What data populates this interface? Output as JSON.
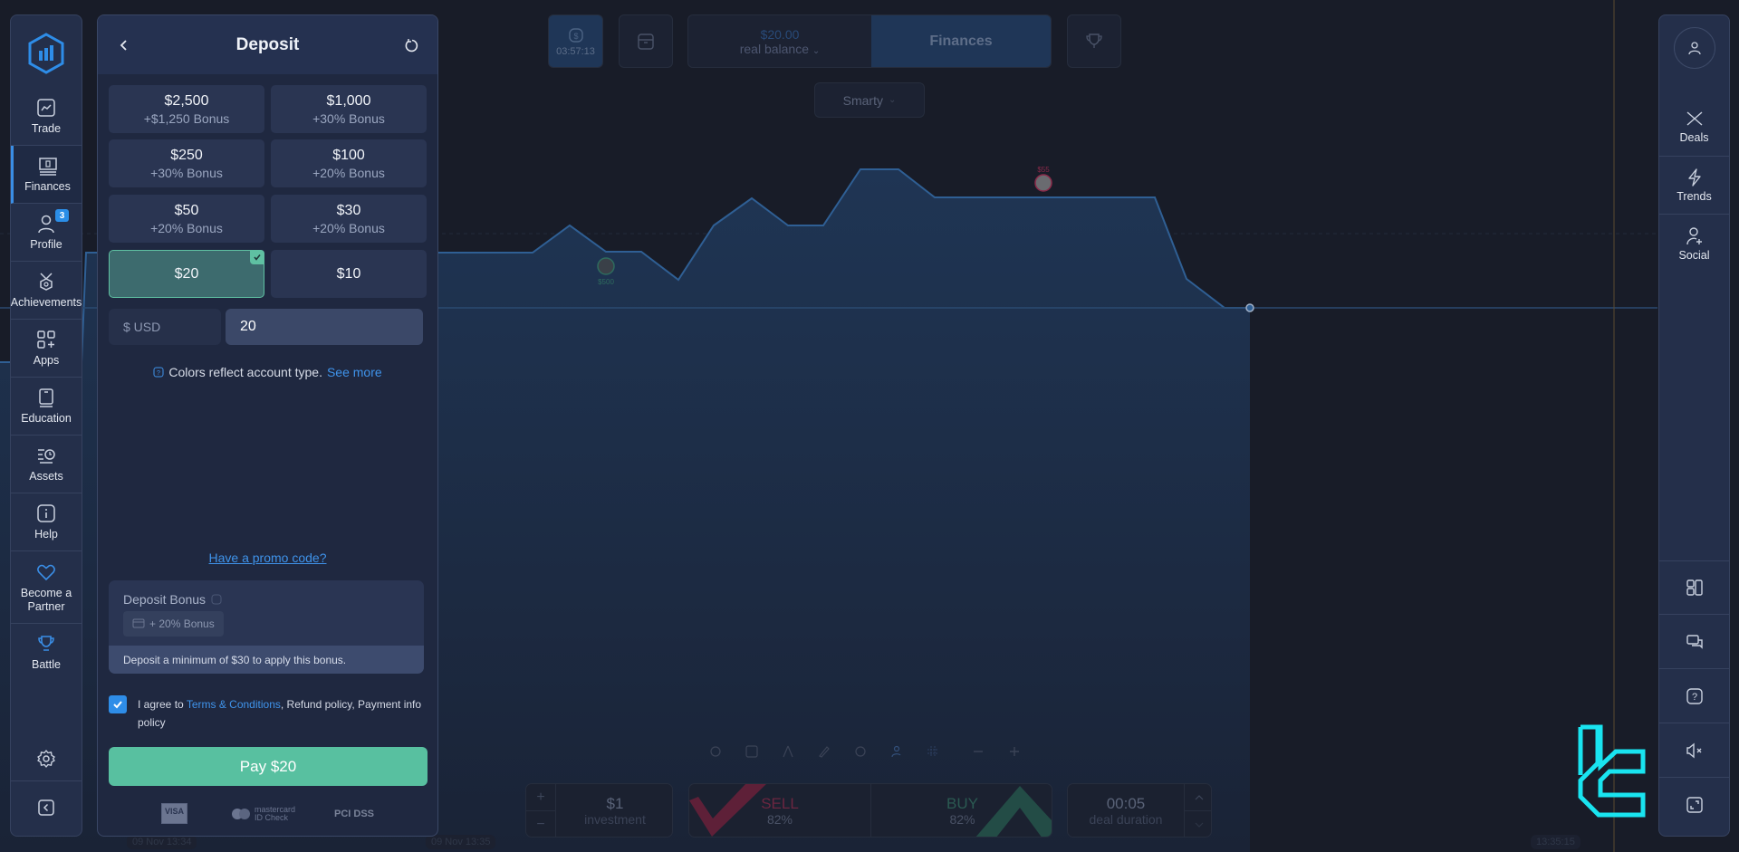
{
  "left_sidebar": {
    "logo": "app-logo",
    "items": [
      {
        "label": "Trade",
        "icon": "chart-line-icon"
      },
      {
        "label": "Finances",
        "icon": "finances-icon",
        "active": true
      },
      {
        "label": "Profile",
        "icon": "user-icon",
        "badge": "3"
      },
      {
        "label": "Achievements",
        "icon": "medal-icon"
      },
      {
        "label": "Apps",
        "icon": "apps-icon"
      },
      {
        "label": "Education",
        "icon": "book-icon"
      },
      {
        "label": "Assets",
        "icon": "assets-icon"
      },
      {
        "label": "Help",
        "icon": "info-icon"
      },
      {
        "label": "Become a Partner",
        "icon": "heart-icon"
      },
      {
        "label": "Battle",
        "icon": "trophy-icon"
      }
    ],
    "settings_icon": "gear-icon",
    "collapse_icon": "collapse-left-icon"
  },
  "deposit": {
    "title": "Deposit",
    "amounts": [
      {
        "value": "$2,500",
        "bonus": "+$1,250 Bonus"
      },
      {
        "value": "$1,000",
        "bonus": "+30% Bonus"
      },
      {
        "value": "$250",
        "bonus": "+30% Bonus"
      },
      {
        "value": "$100",
        "bonus": "+20% Bonus"
      },
      {
        "value": "$50",
        "bonus": "+20% Bonus"
      },
      {
        "value": "$30",
        "bonus": "+20% Bonus"
      },
      {
        "value": "$20",
        "bonus": "",
        "selected": true
      },
      {
        "value": "$10",
        "bonus": ""
      }
    ],
    "currency": "$ USD",
    "amount_value": "20",
    "info_text": "Colors reflect account type.",
    "info_link": "See more",
    "promo_link": "Have a promo code?",
    "bonus": {
      "title": "Deposit Bonus",
      "chip": "+ 20% Bonus",
      "note": "Deposit a minimum of $30 to apply this bonus."
    },
    "agree": {
      "checked": true,
      "prefix": "I agree to ",
      "terms_link": "Terms & Conditions",
      "suffix": ", Refund policy, Payment info policy"
    },
    "pay_button": "Pay $20",
    "payment_logos": [
      "VISA",
      "mastercard ID Check",
      "PCI DSS"
    ]
  },
  "topbar": {
    "timer": "03:57:13",
    "balance_amount": "$20.00",
    "balance_label": "real balance",
    "finances_button": "Finances",
    "strategy": "Smarty"
  },
  "right_sidebar": {
    "items": [
      {
        "label": "Deals",
        "icon": "deals-icon"
      },
      {
        "label": "Trends",
        "icon": "lightning-icon"
      },
      {
        "label": "Social",
        "icon": "add-user-icon"
      }
    ],
    "bottom_icons": [
      "layout-icon",
      "chat-icon",
      "help-icon",
      "sound-mute-icon",
      "fullscreen-icon"
    ]
  },
  "chart": {
    "marker_low_label": "$500",
    "marker_high_label": "$55",
    "dates": [
      "09 Nov 13:34",
      "09 Nov 13:35"
    ],
    "time_label": "13:35:15",
    "series_color": "#2f5f94",
    "fill_color": "#1e3150"
  },
  "trade_panel": {
    "investment_value": "$1",
    "investment_label": "investment",
    "sell_label": "SELL",
    "sell_percent": "82%",
    "buy_label": "BUY",
    "buy_percent": "82%",
    "duration_value": "00:05",
    "duration_label": "deal duration"
  },
  "colors": {
    "accent": "#3a8ee6",
    "pay": "#58c0a0",
    "sell": "#8a2a4a",
    "buy": "#2e6b5e"
  }
}
